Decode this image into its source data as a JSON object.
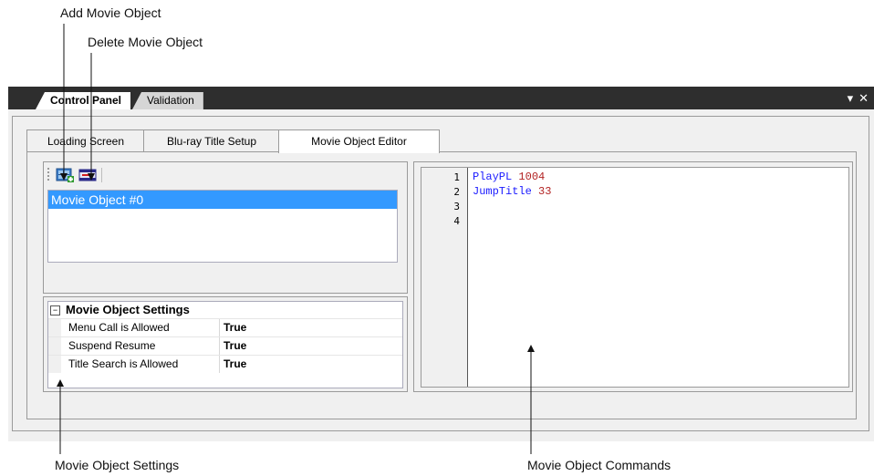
{
  "callouts": {
    "add_movie_object": "Add Movie Object",
    "delete_movie_object": "Delete Movie Object",
    "movie_object_settings": "Movie Object Settings",
    "movie_object_commands": "Movie Object Commands"
  },
  "panel_tabs": [
    "Control Panel",
    "Validation"
  ],
  "titlebar_icons": [
    "dropdown-arrow-icon",
    "close-icon"
  ],
  "editor_tabs": [
    "Loading Screen",
    "Blu-ray Title Setup",
    "Movie Object Editor"
  ],
  "toolbar": {
    "add_icon": "add-movie-object-icon",
    "delete_icon": "delete-movie-object-icon"
  },
  "movie_objects": [
    "Movie Object #0"
  ],
  "settings": {
    "header": "Movie Object Settings",
    "rows": [
      {
        "key": "Menu Call is Allowed",
        "value": "True"
      },
      {
        "key": "Suspend Resume",
        "value": "True"
      },
      {
        "key": "Title Search is Allowed",
        "value": "True"
      }
    ]
  },
  "commands": {
    "line_numbers": [
      "1",
      "2",
      "3",
      "4"
    ],
    "lines": [
      {
        "command": "PlayPL",
        "arg": "1004"
      },
      {
        "command": "JumpTitle",
        "arg": "33"
      }
    ]
  },
  "colors": {
    "command_keyword": "#1a1aff",
    "command_number": "#b22222",
    "selection": "#3399ff",
    "titlebar": "#2e2e2e"
  }
}
